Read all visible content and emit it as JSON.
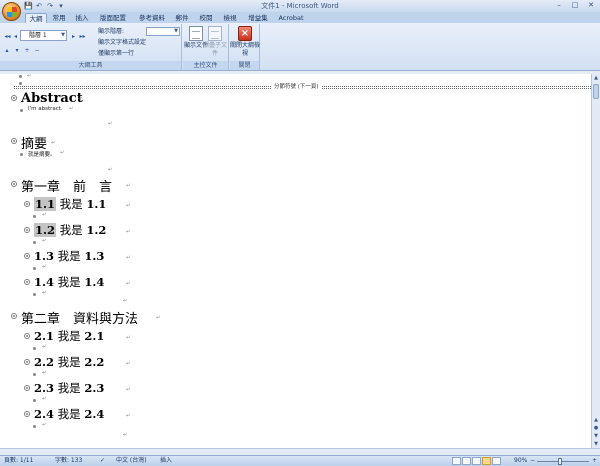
{
  "window": {
    "title": "文件1 - Microsoft Word",
    "minimize": "–",
    "maximize": "□",
    "close": "✕"
  },
  "quick_access": [
    "💾",
    "↶",
    "↷",
    "▾"
  ],
  "tabs": [
    "大綱",
    "常用",
    "插入",
    "版面配置",
    "參考資料",
    "郵件",
    "校閱",
    "檢視",
    "增益集",
    "Acrobat"
  ],
  "active_tab": "大綱",
  "ribbon": {
    "outline_tools": {
      "label": "大綱工具",
      "level_value": "階層 1",
      "promote_top": "◂◂",
      "promote": "◂",
      "demote": "▸",
      "demote_body": "▸▸",
      "move_up": "▴",
      "move_down": "▾",
      "expand": "+",
      "collapse": "−",
      "show_level": "顯示階層:",
      "show_text_format": "顯示文字格式設定",
      "show_first_line": "僅顯示第一行"
    },
    "master_document": {
      "label": "主控文件",
      "show_document": "顯示文件",
      "collapse_subdocuments": "摺疊子文件"
    },
    "close": {
      "label": "關閉",
      "close_outline_view": "關閉大綱檢視"
    }
  },
  "document": {
    "section_break": "分節符號 (下一頁)",
    "paragraph_mark": "↵",
    "headings": [
      {
        "level": 1,
        "text": "Abstract",
        "bold": true,
        "body": "I'm abstract."
      },
      {
        "level": 1,
        "text": "摘要",
        "bold": false,
        "body": "就是摘要。"
      },
      {
        "level": 1,
        "text": "第一章　前　言",
        "bold": false,
        "body": ""
      },
      {
        "level": 2,
        "num": "1.1",
        "text": "我是",
        "suffix": "1.1",
        "selected": true
      },
      {
        "level": 2,
        "num": "1.2",
        "text": "我是",
        "suffix": "1.2",
        "selected": true
      },
      {
        "level": 2,
        "num": "1.3",
        "text": "我是",
        "suffix": "1.3",
        "selected": false
      },
      {
        "level": 2,
        "num": "1.4",
        "text": "我是",
        "suffix": "1.4",
        "selected": false
      },
      {
        "level": 1,
        "text": "第二章　資料與方法",
        "bold": false,
        "body": ""
      },
      {
        "level": 2,
        "num": "2.1",
        "text": "我是",
        "suffix": "2.1",
        "selected": false
      },
      {
        "level": 2,
        "num": "2.2",
        "text": "我是",
        "suffix": "2.2",
        "selected": false
      },
      {
        "level": 2,
        "num": "2.3",
        "text": "我是",
        "suffix": "2.3",
        "selected": false
      },
      {
        "level": 2,
        "num": "2.4",
        "text": "我是",
        "suffix": "2.4",
        "selected": false
      }
    ]
  },
  "status_bar": {
    "page": "頁數: 1/11",
    "words": "字數: 133",
    "language": "中文 (台灣)",
    "insert_mode": "插入",
    "zoom": "90%",
    "zoom_out": "−",
    "zoom_in": "+",
    "zoom_percent": 90
  }
}
